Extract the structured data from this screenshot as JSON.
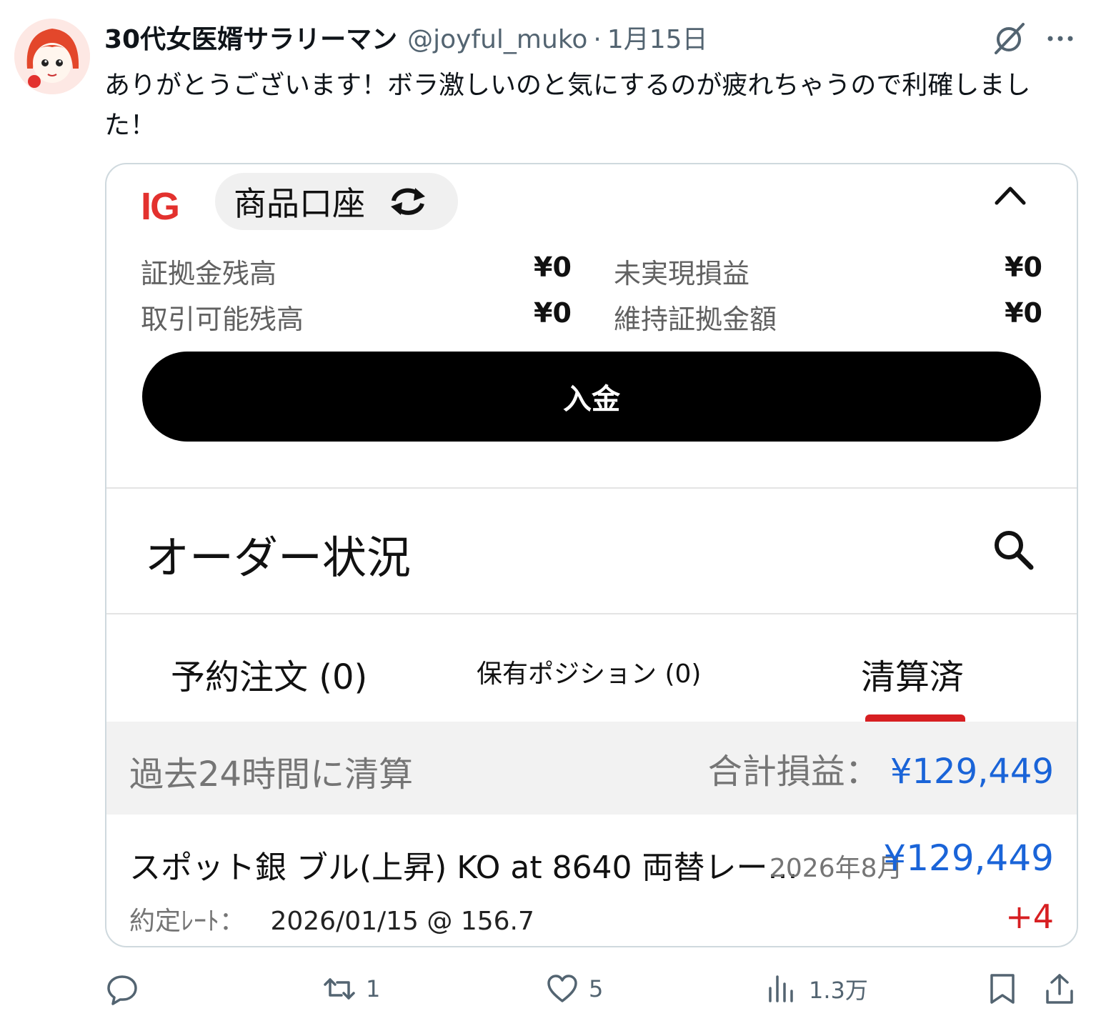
{
  "tweet": {
    "author_name": "30代女医婿サラリーマン",
    "handle": "@joyful_muko",
    "separator": "·",
    "date": "1月15日",
    "text": "ありがとうございます！ボラ激しいのと気にするのが疲れちゃうので利確しました！"
  },
  "app": {
    "logo": "IG",
    "account_label": "商品口座",
    "balances": {
      "margin_balance_label": "証拠金残高",
      "margin_balance_value": "¥0",
      "unrealized_pl_label": "未実現損益",
      "unrealized_pl_value": "¥0",
      "tradable_balance_label": "取引可能残高",
      "tradable_balance_value": "¥0",
      "maintenance_margin_label": "維持証拠金額",
      "maintenance_margin_value": "¥0"
    },
    "deposit_label": "入金",
    "order_status_title": "オーダー状況",
    "tabs": [
      {
        "label": "予約注文 (0)"
      },
      {
        "label": "保有ポジション (0)"
      },
      {
        "label": "清算済"
      }
    ],
    "settled": {
      "period_label": "過去24時間に清算",
      "total_label": "合計損益：",
      "total_value": "¥129,449"
    },
    "item": {
      "name": "スポット銀 ブル(上昇) KO at 8640 両替レー...",
      "expiry": "2026年8月",
      "pl": "¥129,449",
      "rate_label": "約定ﾚｰﾄ：",
      "rate_value": "2026/01/15 @ 156.7",
      "change": "+4"
    }
  },
  "actions": {
    "reply_count": "",
    "retweet_count": "1",
    "like_count": "5",
    "views_count": "1.3万"
  },
  "colors": {
    "ig_red": "#e3312e",
    "profit_blue": "#1a64d8",
    "change_red": "#d71f22",
    "muted_gray": "#536471"
  }
}
